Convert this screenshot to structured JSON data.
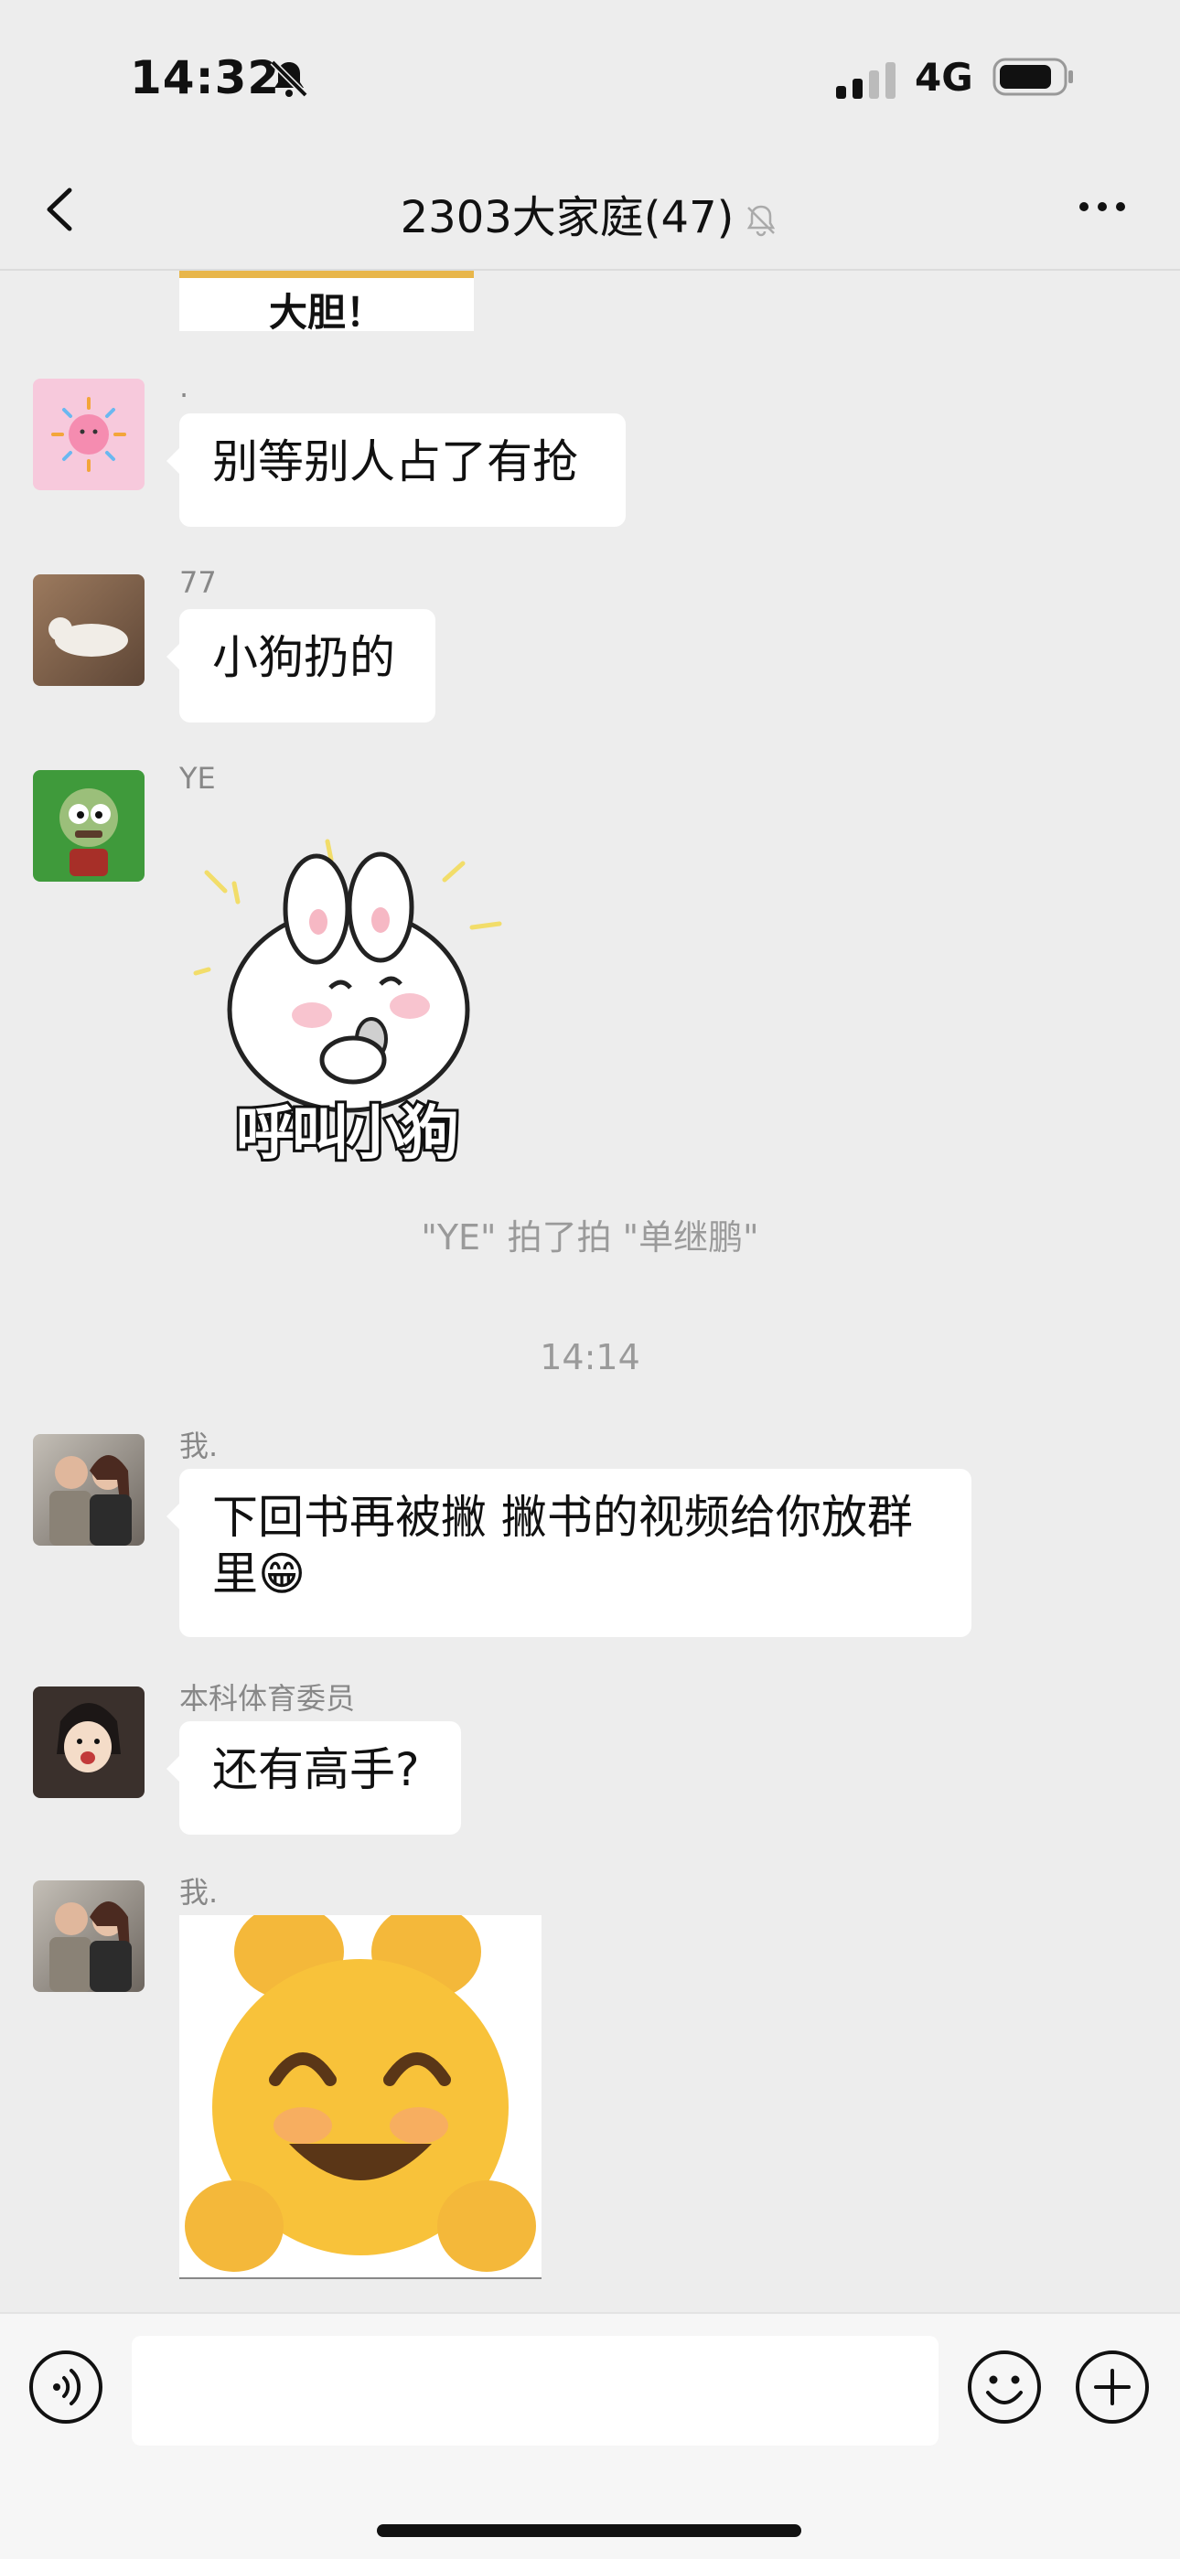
{
  "status_bar": {
    "time": "14:32",
    "network": "4G"
  },
  "nav": {
    "title": "2303大家庭(47)"
  },
  "messages": [
    {
      "type": "image",
      "caption": "大胆！"
    },
    {
      "type": "text",
      "sender": ".",
      "text": "别等别人占了有抢"
    },
    {
      "type": "text",
      "sender": "77",
      "text": "小狗扔的"
    },
    {
      "type": "sticker",
      "sender": "YE",
      "sticker_text": "呼叫小狗"
    },
    {
      "type": "system",
      "text": "\"YE\" 拍了拍 \"单继鹏\""
    },
    {
      "type": "time",
      "text": "14:14"
    },
    {
      "type": "text",
      "sender": "我.",
      "text": "下回书再被撇 撇书的视频给你放群里😁"
    },
    {
      "type": "text",
      "sender": "本科体育委员",
      "text": "还有高手?"
    },
    {
      "type": "sticker",
      "sender": "我.",
      "sticker_text": ""
    }
  ],
  "input": {
    "placeholder": ""
  },
  "icons": {
    "back": "chevron-left-icon",
    "mute": "bell-slash-icon",
    "more": "more-dots-icon",
    "voice": "voice-icon",
    "emoji": "emoji-icon",
    "plus": "plus-icon"
  }
}
